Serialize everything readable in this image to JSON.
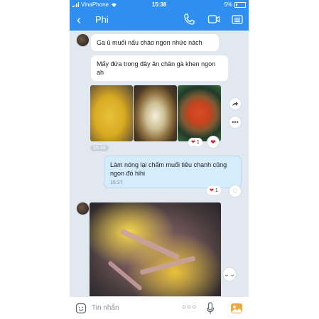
{
  "status_bar": {
    "carrier": "VinaPhone",
    "time": "15:38",
    "battery": "5%"
  },
  "header": {
    "back_icon": "chevron-left-icon",
    "contact_name": "Phi",
    "call_icon": "phone-icon",
    "video_icon": "video-icon",
    "menu_icon": "list-icon"
  },
  "messages": [
    {
      "from": "other",
      "text": "Ga ủ  muối nấu cháo ngon nhức nách"
    },
    {
      "from": "other",
      "text": "Mấy đứa trong đây ăn chân gà khen ngon ah"
    },
    {
      "from": "other",
      "type": "photos",
      "time": "15:34",
      "reaction_count": "1"
    },
    {
      "from": "me",
      "text": "Làm nóng lại chấm muối tiêu chanh cũng ngon đó hihi",
      "time": "15:37",
      "reaction_count": "1"
    },
    {
      "from": "other",
      "type": "photo"
    }
  ],
  "input": {
    "placeholder": "Tin nhắn"
  },
  "colors": {
    "brand": "#2e8ff0",
    "chat_bg": "#e2e8ef",
    "my_bubble": "#d5ecfd"
  }
}
